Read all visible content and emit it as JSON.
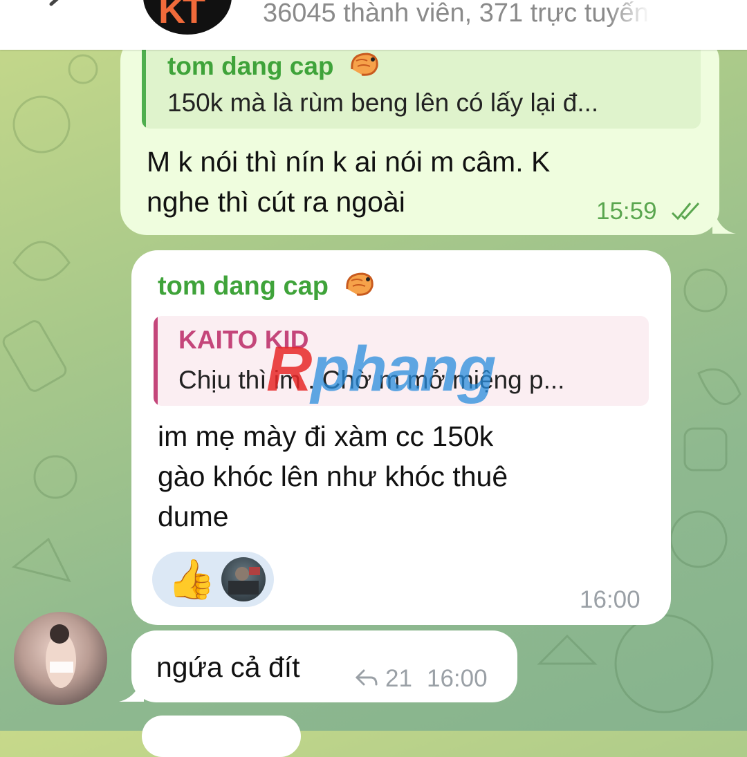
{
  "header": {
    "members_text": "36045 thành viên, 371 trực tuyến"
  },
  "messages": [
    {
      "reply": {
        "author": "tom dang cap",
        "text": "150k mà là rùm beng lên có lấy lại đ..."
      },
      "lines": [
        "M k nói thì nín k ai nói m câm. K",
        "nghe thì cút ra ngoài"
      ],
      "time": "15:59"
    },
    {
      "sender": "tom dang cap",
      "reply": {
        "author": "KAITO KID",
        "text": "Chịu thì im . Chờ m mở miệng p..."
      },
      "lines": [
        "im mẹ mày đi xàm cc 150k",
        "gào khóc lên như khóc thuê",
        "dume"
      ],
      "reaction": "👍",
      "time": "16:00"
    },
    {
      "text": "ngứa cả đít",
      "reply_count": "21",
      "time": "16:00"
    }
  ],
  "watermark": {
    "part1": "R",
    "part2": "phang"
  },
  "colors": {
    "outgoing_bubble": "#effdde",
    "incoming_bubble": "#ffffff",
    "name_green": "#3fa33a",
    "reply_red": "#c4467a"
  }
}
